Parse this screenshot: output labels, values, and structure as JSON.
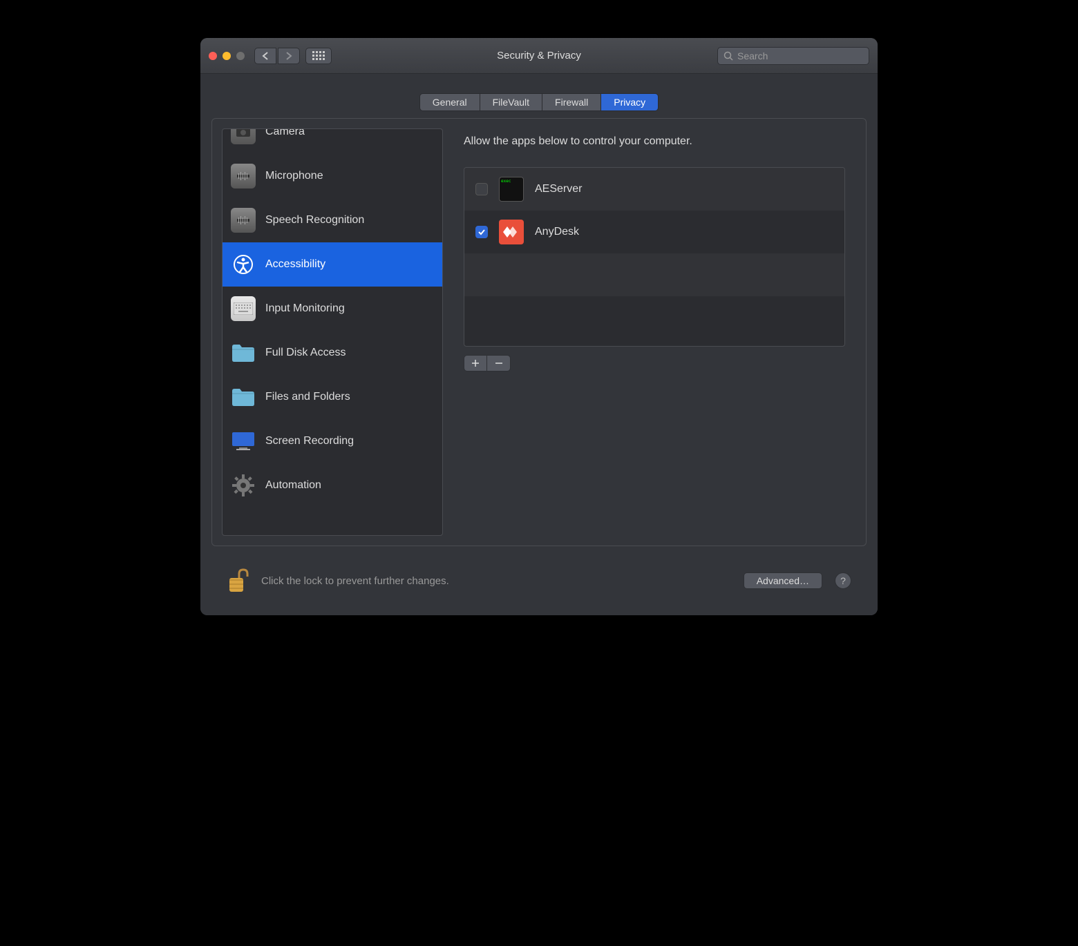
{
  "window": {
    "title": "Security & Privacy"
  },
  "search": {
    "placeholder": "Search",
    "value": ""
  },
  "tabs": {
    "items": [
      {
        "label": "General",
        "active": false
      },
      {
        "label": "FileVault",
        "active": false
      },
      {
        "label": "Firewall",
        "active": false
      },
      {
        "label": "Privacy",
        "active": true
      }
    ]
  },
  "sidebar": {
    "items": [
      {
        "label": "Camera",
        "icon": "camera",
        "selected": false
      },
      {
        "label": "Microphone",
        "icon": "microphone",
        "selected": false
      },
      {
        "label": "Speech Recognition",
        "icon": "speech",
        "selected": false
      },
      {
        "label": "Accessibility",
        "icon": "accessibility",
        "selected": true
      },
      {
        "label": "Input Monitoring",
        "icon": "keyboard",
        "selected": false
      },
      {
        "label": "Full Disk Access",
        "icon": "folder",
        "selected": false
      },
      {
        "label": "Files and Folders",
        "icon": "folder",
        "selected": false
      },
      {
        "label": "Screen Recording",
        "icon": "display",
        "selected": false
      },
      {
        "label": "Automation",
        "icon": "gear",
        "selected": false
      }
    ]
  },
  "detail": {
    "description": "Allow the apps below to control your computer.",
    "apps": [
      {
        "name": "AEServer",
        "checked": false,
        "icon": "exec"
      },
      {
        "name": "AnyDesk",
        "checked": true,
        "icon": "anydesk"
      }
    ]
  },
  "footer": {
    "lock_text": "Click the lock to prevent further changes.",
    "advanced_label": "Advanced…",
    "help_label": "?"
  }
}
